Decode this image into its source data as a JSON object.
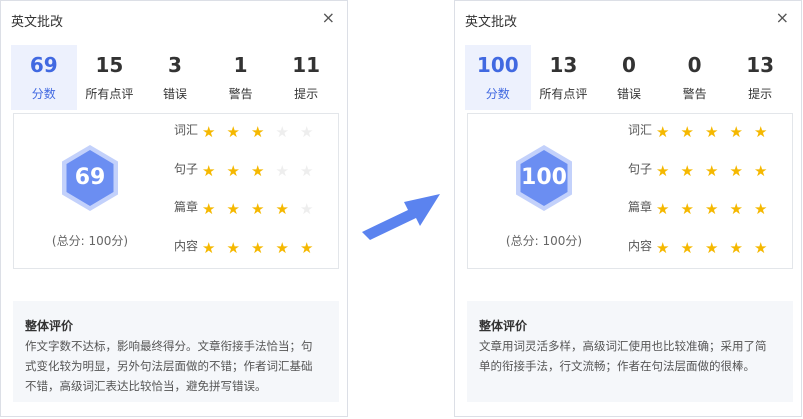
{
  "colors": {
    "accent": "#4169e1",
    "star": "#f5b800",
    "star_empty": "#eeeeee",
    "hex": "#6b8ef2",
    "arrow": "#5b83ef"
  },
  "icons": {
    "close": "close-icon",
    "star": "star-icon",
    "arrow": "arrow-right-icon"
  },
  "left": {
    "title": "英文批改",
    "close": "×",
    "stats": [
      {
        "value": "69",
        "label": "分数"
      },
      {
        "value": "15",
        "label": "所有点评"
      },
      {
        "value": "3",
        "label": "错误"
      },
      {
        "value": "1",
        "label": "警告"
      },
      {
        "value": "11",
        "label": "提示"
      }
    ],
    "score": "69",
    "total": "(总分: 100分)",
    "ratings": [
      {
        "label": "词汇",
        "stars": 3
      },
      {
        "label": "句子",
        "stars": 3
      },
      {
        "label": "篇章",
        "stars": 3.5
      },
      {
        "label": "内容",
        "stars": 4.5
      }
    ],
    "summary_title": "整体评价",
    "summary_lines": [
      "作文字数不达标，影响最终得分。文章衔接手法恰当；句",
      "式变化较为明显，另外句法层面做的不错；作者词汇基础",
      "不错，高级词汇表达比较恰当，避免拼写错误。"
    ]
  },
  "right": {
    "title": "英文批改",
    "close": "×",
    "stats": [
      {
        "value": "100",
        "label": "分数"
      },
      {
        "value": "13",
        "label": "所有点评"
      },
      {
        "value": "0",
        "label": "错误"
      },
      {
        "value": "0",
        "label": "警告"
      },
      {
        "value": "13",
        "label": "提示"
      }
    ],
    "score": "100",
    "total": "(总分: 100分)",
    "ratings": [
      {
        "label": "词汇",
        "stars": 5
      },
      {
        "label": "句子",
        "stars": 5
      },
      {
        "label": "篇章",
        "stars": 5
      },
      {
        "label": "内容",
        "stars": 5
      }
    ],
    "summary_title": "整体评价",
    "summary_lines": [
      "文章用词灵活多样，高级词汇使用也比较准确；采用了简",
      "单的衔接手法，行文流畅；作者在句法层面做的很棒。"
    ]
  }
}
